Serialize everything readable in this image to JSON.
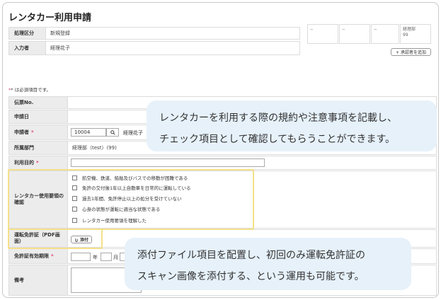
{
  "page": {
    "title": "レンタカー利用申請",
    "required_note": "* は必須項目です。",
    "required_mark": "*"
  },
  "header_fields": {
    "process_type": {
      "label": "処理区分",
      "value": "新規登録"
    },
    "entered_by": {
      "label": "入力者",
      "value": "経理花子"
    }
  },
  "approvers": {
    "slots": [
      "--",
      "--",
      "--"
    ],
    "last_dept": "経理部",
    "last_code": "99",
    "add_button": "+ 承認者を追加"
  },
  "form": {
    "slip_no": {
      "label": "伝票No.",
      "value": ""
    },
    "apply_date": {
      "label": "申請日",
      "value": ""
    },
    "applicant": {
      "label": "申請者",
      "code": "10004",
      "name": "経理花子"
    },
    "department": {
      "label": "所属部門",
      "value": "経理部（test）(99)"
    },
    "purpose": {
      "label": "利用目的",
      "value": ""
    },
    "rules": {
      "label": "レンタカー使用要領の確認",
      "items": [
        "航空機、鉄道、船舶及びバスでの移動が困難である",
        "免許の交付後1年以上自動車を日常的に運転している",
        "過去1年間、免許停止以上の処分を受けていない",
        "心身の状態が運転に適当な状態である",
        "レンタカー使用要領を理解した"
      ]
    },
    "license_file": {
      "label": "運転免許証（PDF画面）",
      "button": "添付"
    },
    "license_expiry": {
      "label": "免許証有効期限",
      "year_unit": "年",
      "month_unit": "月"
    },
    "notes": {
      "label": "備考"
    }
  },
  "callouts": {
    "top": {
      "line1": "レンタカーを利用する際の規約や注意事項を記載し、",
      "line2": "チェック項目として確認してもらうことができます。"
    },
    "bottom": {
      "line1": "添付ファイル項目を配置し、初回のみ運転免許証の",
      "line2": "スキャン画像を添付する、という運用も可能です。"
    }
  },
  "colors": {
    "highlight": "#f5e08a",
    "bubble": "#e6f1fa",
    "required": "#e0477a"
  }
}
